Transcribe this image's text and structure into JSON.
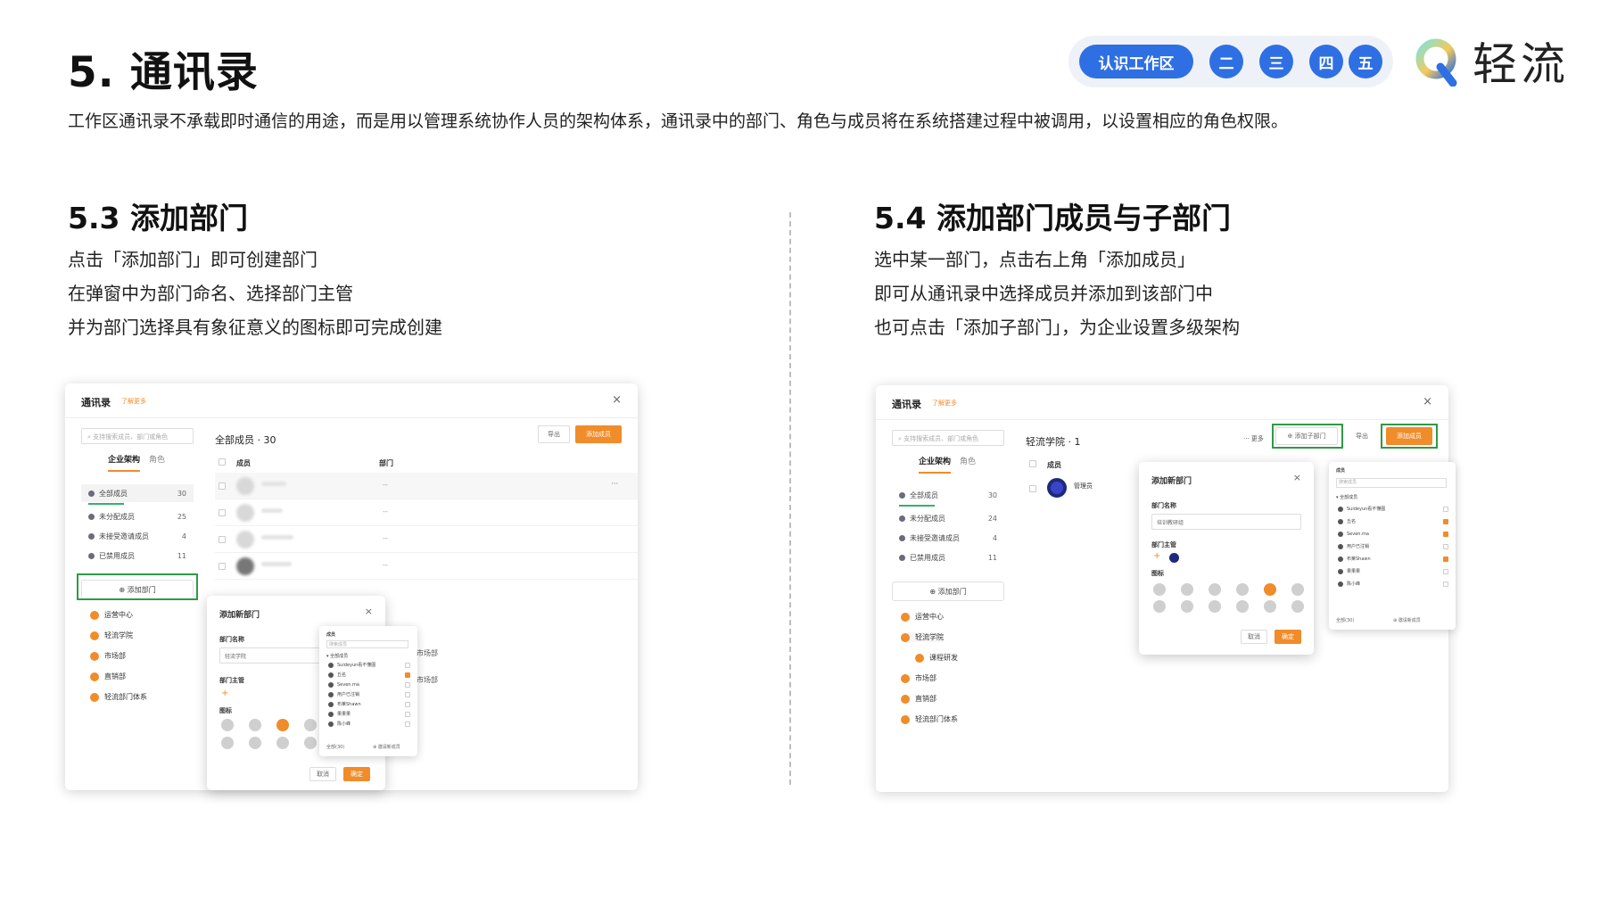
{
  "header": {
    "title": "5. 通讯录",
    "description": "工作区通讯录不承载即时通信的用途，而是用以管理系统协作人员的架构体系，通讯录中的部门、角色与成员将在系统搭建过程中被调用，以设置相应的角色权限。"
  },
  "nav": {
    "main": "认识工作区",
    "items": [
      "二",
      "三",
      "四",
      "五"
    ]
  },
  "brand": {
    "name": "轻流"
  },
  "colors": {
    "accent": "#2f6fe4",
    "orange": "#f08c2a",
    "highlight": "#2f9a45"
  },
  "left": {
    "title": "5.3 添加部门",
    "lines": [
      "点击「添加部门」即可创建部门",
      "在弹窗中为部门命名、选择部门主管",
      "并为部门选择具有象征意义的图标即可完成创建"
    ],
    "mock": {
      "title": "通讯录",
      "more": "了解更多",
      "search": "支持搜索成员、部门或角色",
      "tabs": [
        "企业架构",
        "角色"
      ],
      "stats": [
        {
          "label": "全部成员",
          "count": "30"
        },
        {
          "label": "未分配成员",
          "count": "25"
        },
        {
          "label": "未接受邀请成员",
          "count": "4"
        },
        {
          "label": "已禁用成员",
          "count": "11"
        }
      ],
      "add_dept": "⊕ 添加部门",
      "depts": [
        "运营中心",
        "轻流学院",
        "市场部",
        "直销部",
        "轻流部门体系"
      ],
      "main_head": "全部成员 · 30",
      "export": "导出",
      "add_member": "添加成员",
      "col_member": "成员",
      "col_dept": "部门",
      "dash": "--",
      "ellipsis": "···",
      "popup": {
        "title": "添加新部门",
        "name_label": "部门名称",
        "name_value": "轻流学院",
        "head_label": "部门主管",
        "plus": "+",
        "icon_label": "图标",
        "cancel": "取消",
        "confirm": "确定"
      },
      "picker": {
        "header": "成员",
        "search": "搜索成员",
        "group": "全部成员",
        "rows": [
          "Suideyun看不懂图",
          "丘名",
          "Seven.ma",
          "用户已注销",
          "布莱Shawn",
          "果果果",
          "陈小峰"
        ],
        "footer_left": "全部(30)",
        "footer_right": "⊕ 邀请新成员"
      },
      "side_text": [
        "市场部",
        "市场部"
      ]
    }
  },
  "right": {
    "title": "5.4 添加部门成员与子部门",
    "lines": [
      "选中某一部门，点击右上角「添加成员」",
      "即可从通讯录中选择成员并添加到该部门中",
      "也可点击「添加子部门」，为企业设置多级架构"
    ],
    "mock": {
      "title": "通讯录",
      "more": "了解更多",
      "search": "支持搜索成员、部门或角色",
      "tabs": [
        "企业架构",
        "角色"
      ],
      "stats": [
        {
          "label": "全部成员",
          "count": "30"
        },
        {
          "label": "未分配成员",
          "count": "24"
        },
        {
          "label": "未接受邀请成员",
          "count": "4"
        },
        {
          "label": "已禁用成员",
          "count": "11"
        }
      ],
      "add_dept": "⊕ 添加部门",
      "depts": [
        "运营中心",
        "轻流学院",
        "课程研发",
        "市场部",
        "直销部",
        "轻流部门体系"
      ],
      "main_head": "轻流学院 · 1",
      "more_btn": "··· 更多",
      "add_sub": "⊕ 添加子部门",
      "export": "导出",
      "add_member": "添加成员",
      "col_member": "成员",
      "admin": "管理员",
      "popup": {
        "title": "添加新部门",
        "name_label": "部门名称",
        "name_value": "培训教研组",
        "head_label": "部门主管",
        "plus": "+",
        "icon_label": "图标",
        "cancel": "取消",
        "confirm": "确定"
      },
      "picker": {
        "header": "成员",
        "search": "搜索成员",
        "group": "全部成员",
        "rows": [
          "Suideyun看不懂图",
          "丘名",
          "Seven.ma",
          "用户已注销",
          "布莱Shawn",
          "果果果",
          "陈小峰"
        ],
        "footer_left": "全部(30)",
        "footer_right": "⊕ 邀请新成员"
      }
    }
  }
}
